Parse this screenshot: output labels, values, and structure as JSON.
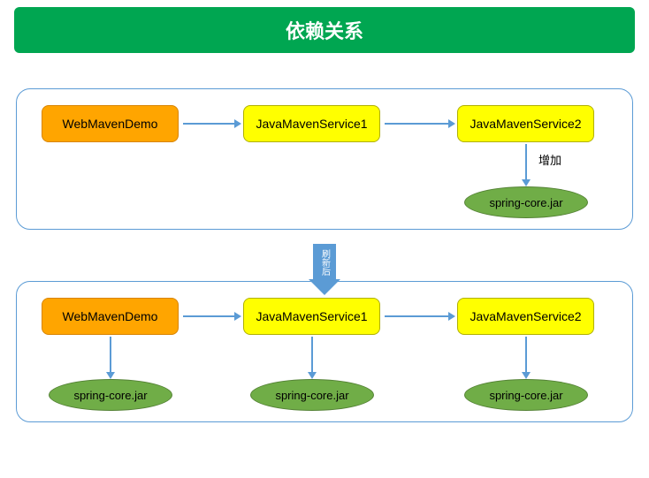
{
  "title": "依赖关系",
  "top_panel": {
    "node1": "WebMavenDemo",
    "node2": "JavaMavenService1",
    "node3": "JavaMavenService2",
    "add_label": "增加",
    "jar": "spring-core.jar"
  },
  "transition_label": "刷新后",
  "bottom_panel": {
    "node1": "WebMavenDemo",
    "node2": "JavaMavenService1",
    "node3": "JavaMavenService2",
    "jar1": "spring-core.jar",
    "jar2": "spring-core.jar",
    "jar3": "spring-core.jar"
  }
}
